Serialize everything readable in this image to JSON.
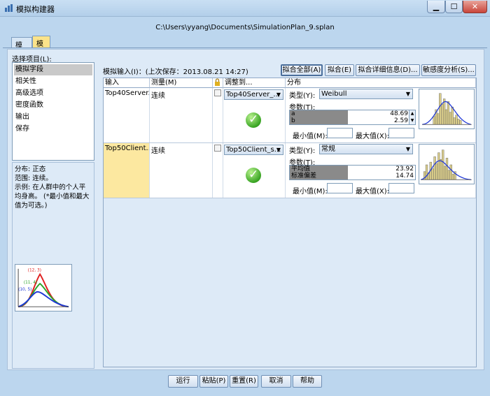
{
  "window": {
    "title": "模拟构建器",
    "close_label": "✕",
    "min_label": "▁",
    "max_label": "☐"
  },
  "file_path": "C:\\Users\\yyang\\Documents\\SimulationPlan_9.splan",
  "tabs": [
    {
      "label": "模型"
    },
    {
      "label": "模拟",
      "active": true
    }
  ],
  "selection_label": "选择项目(L):",
  "nav": {
    "items": [
      "模拟字段",
      "相关性",
      "高级选项",
      "密度函数",
      "输出",
      "保存"
    ],
    "selected": 0
  },
  "description": "分布: 正态\n范围: 连续。\n示例: 在人群中的个人平均身高。 (*最小值和最大值为可选。)",
  "mini_chart_labels": {
    "a": "(12, 3)",
    "b": "(11, 4)",
    "c": "(10, 5)"
  },
  "inputs_header": "模拟输入(I)：(上次保存：2013.08.21 14:27)",
  "toolbar": {
    "fit_all": "拟合全部(A)",
    "fit": "拟合(E)",
    "fit_details": "拟合详细信息(D)...",
    "sensitivity": "敏感度分析(S)..."
  },
  "columns": {
    "input": "输入",
    "measure": "测量(M)",
    "lock_icon": "lock-icon",
    "fit_to": "调整到...",
    "distribution": "分布"
  },
  "rows": [
    {
      "input": "Top40Server...",
      "measure": "连续",
      "fit_to": "Top40Server_...",
      "type_label": "类型(Y):",
      "type_value": "Weibull",
      "params_label": "参数(T):",
      "params": [
        {
          "name": "a",
          "value": "48.69"
        },
        {
          "name": "b",
          "value": "2.59"
        }
      ],
      "min_label": "最小值(M):",
      "max_label": "最大值(X):"
    },
    {
      "input": "Top50Client...",
      "measure": "连续",
      "fit_to": "Top50Client_s...",
      "type_label": "类型(Y):",
      "type_value": "常规",
      "params_label": "参数(T):",
      "params": [
        {
          "name": "平均值",
          "value": "23.92"
        },
        {
          "name": "标准偏差",
          "value": "14.74"
        }
      ],
      "min_label": "最小值(M):",
      "max_label": "最大值(X):"
    }
  ],
  "bottom_buttons": {
    "run": "运行",
    "paste": "粘贴(P)",
    "reset": "重置(R)",
    "cancel": "取消",
    "help": "帮助"
  },
  "colors": {
    "highlight": "#fce8a0",
    "tab_active": "#fbe38a",
    "curve": "#1f37d6",
    "bar": "#d9cc8a"
  }
}
